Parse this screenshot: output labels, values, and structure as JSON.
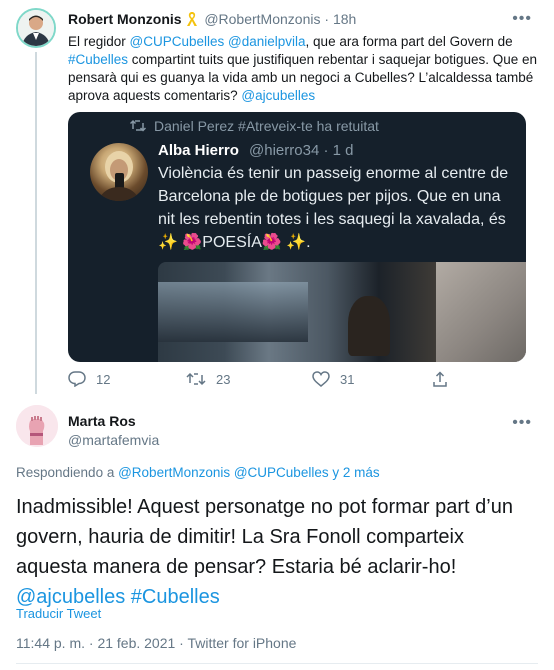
{
  "tweet": {
    "author_name": "Robert Monzonis",
    "author_handle": "@RobertMonzonis",
    "separator": "·",
    "time": "18h",
    "text_parts": [
      {
        "t": "El regidor ",
        "link": false
      },
      {
        "t": "@CUPCubelles",
        "link": true
      },
      {
        "t": " ",
        "link": false
      },
      {
        "t": "@danielpvila",
        "link": true
      },
      {
        "t": ", que ara forma part del Govern de ",
        "link": false
      },
      {
        "t": "#Cubelles",
        "link": true
      },
      {
        "t": " compartint tuits que justifiquen rebentar i saquejar botigues. Que en pensarà qui es guanya la vida amb un negoci a Cubelles? L’alcaldessa també aprova aquests comentaris? ",
        "link": false
      },
      {
        "t": "@ajcubelles",
        "link": true
      }
    ],
    "quote": {
      "retweet_label": "Daniel Perez #Atreveix-te ha retuitat",
      "author_name": "Alba Hierro",
      "author_meta": "@hierro34 · 1 d",
      "text": "Violència és tenir un passeig enorme al centre de Barcelona ple de botigues per pijos. Que en una nit les rebentin totes i les saquegi la xavalada, és ✨ 🌺POESÍA🌺 ✨."
    },
    "actions": {
      "replies": "12",
      "retweets": "23",
      "likes": "31"
    }
  },
  "reply": {
    "author_name": "Marta Ros",
    "author_handle": "@martafemvia",
    "replying_prefix": "Respondiendo a ",
    "replying_to": "@RobertMonzonis @CUPCubelles y 2 más",
    "text": "Inadmissible! Aquest personatge no pot formar part d’un govern, hauria de dimitir! La Sra Fonoll comparteix aquesta manera de pensar? Estaria bé aclarir-ho!",
    "hashtags": "@ajcubelles #Cubelles",
    "translate_label": "Traducir Tweet",
    "meta": "11:44 p. m. · 21 feb. 2021 · Twitter for iPhone"
  },
  "colors": {
    "accent": "#1b95e0",
    "quote_bg": "#15202b",
    "muted": "#657786"
  }
}
